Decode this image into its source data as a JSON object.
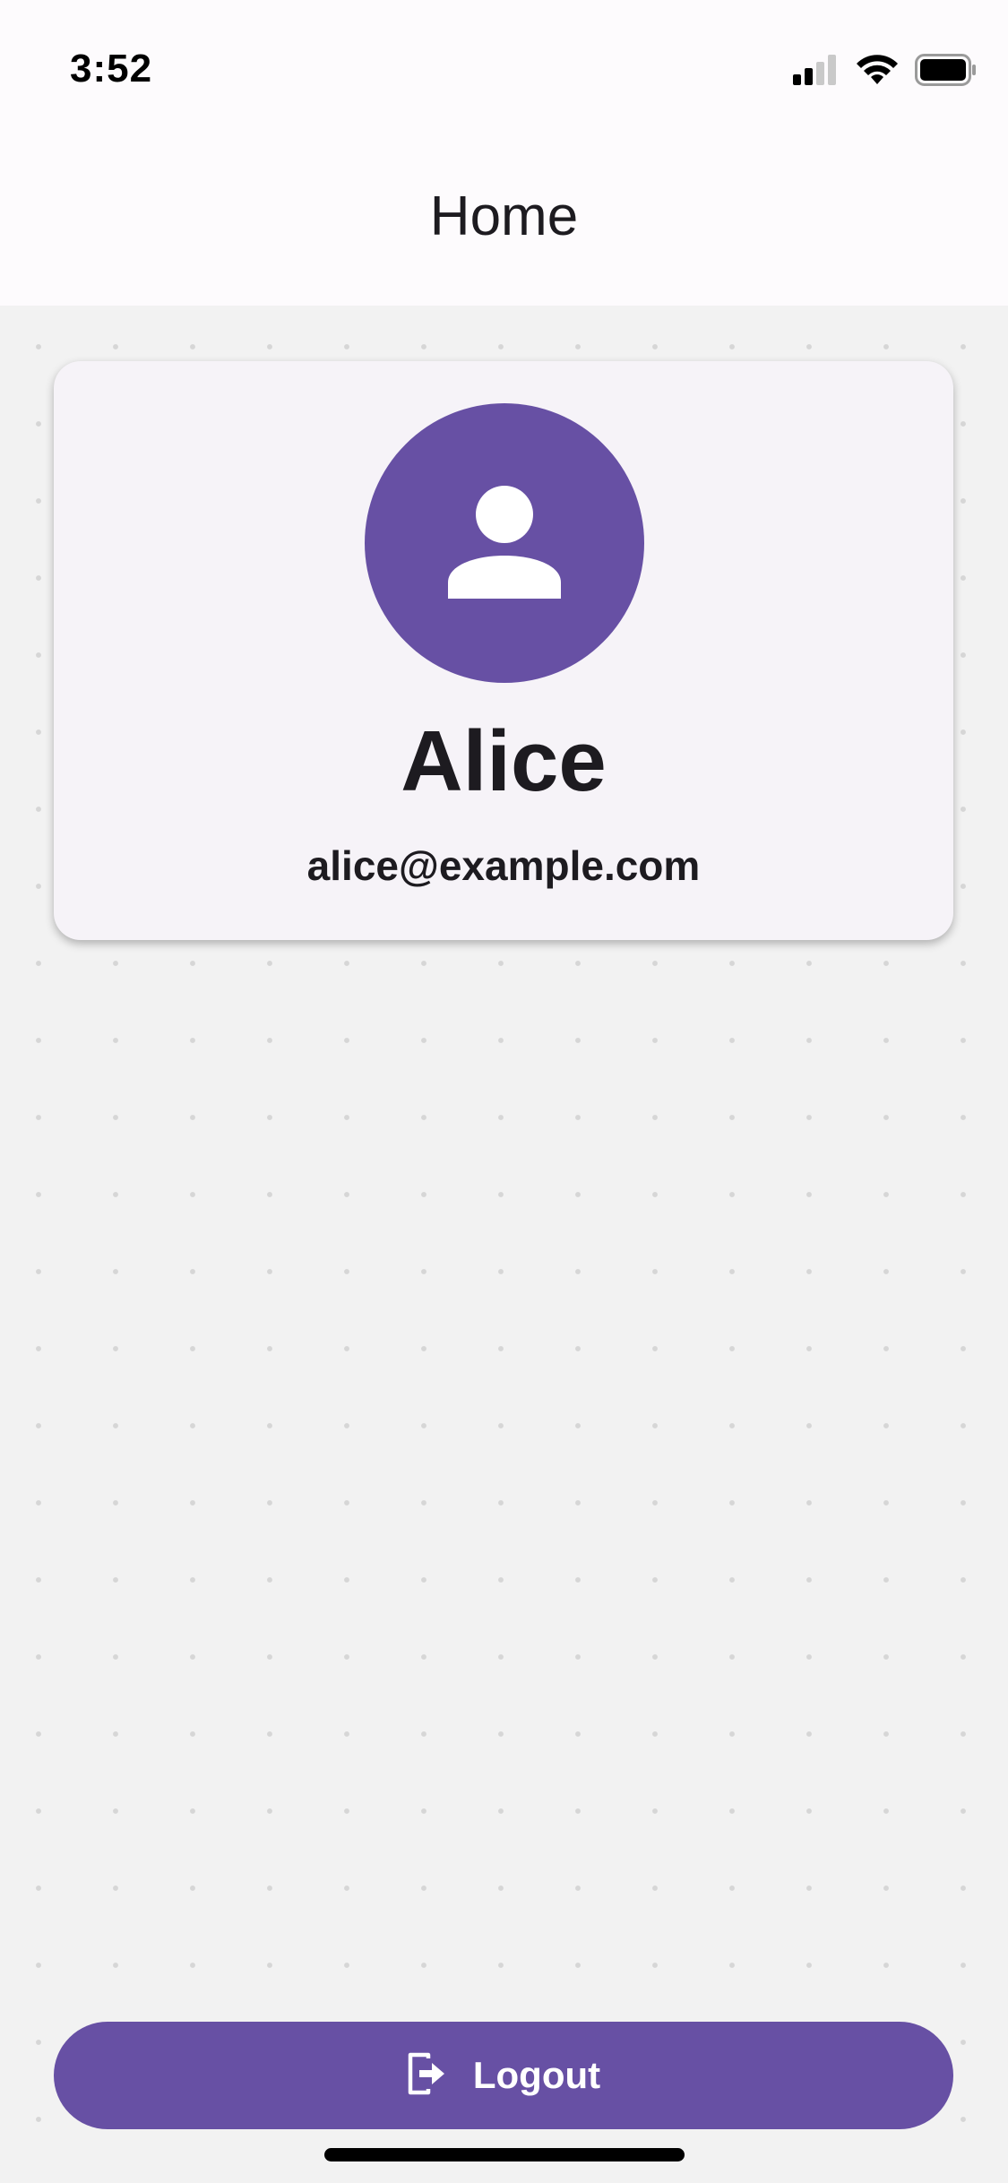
{
  "status_bar": {
    "time": "3:52",
    "icons": [
      "cellular-signal-icon",
      "wifi-icon",
      "battery-icon"
    ]
  },
  "nav": {
    "title": "Home"
  },
  "profile": {
    "avatar_icon": "person-icon",
    "name": "Alice",
    "email": "alice@example.com"
  },
  "actions": {
    "logout_label": "Logout",
    "logout_icon": "logout-icon"
  },
  "colors": {
    "primary": "#6750a4",
    "card_background": "#f6f3f8",
    "page_background": "#f2f2f2",
    "header_background": "#fdfbfd",
    "text": "#1d1b20"
  }
}
